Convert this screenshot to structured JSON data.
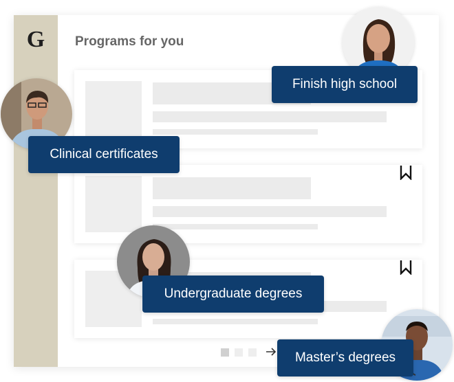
{
  "app": {
    "logo_text": "G",
    "page_title": "Programs for you"
  },
  "tags": {
    "finish_high_school": "Finish high school",
    "clinical_certificates": "Clinical certificates",
    "undergraduate_degrees": "Undergraduate degrees",
    "masters_degrees": "Master’s degrees"
  },
  "icons": {
    "bookmark": "bookmark-icon",
    "next": "arrow-right-icon",
    "logo": "logo-monogram"
  },
  "pager": {
    "pages": 3,
    "current": 1
  },
  "colors": {
    "sidebar": "#d7d1bd",
    "tag_background": "#0f3d6e",
    "tag_text": "#ffffff",
    "title": "#666666",
    "placeholder": "#ebebeb"
  }
}
